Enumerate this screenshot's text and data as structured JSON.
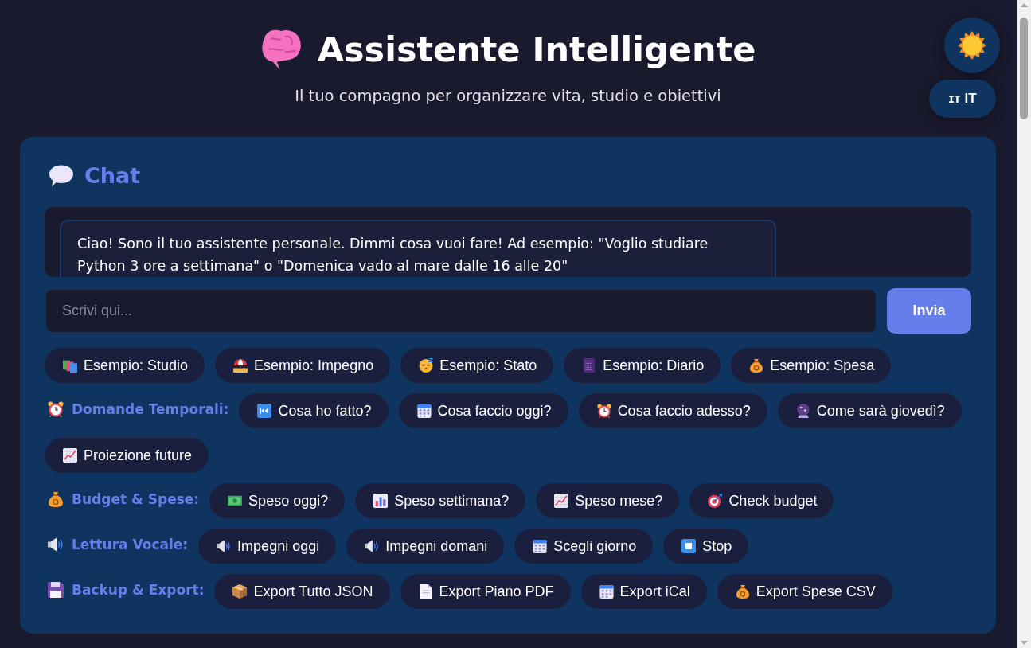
{
  "header": {
    "title": "Assistente Intelligente",
    "subtitle": "Il tuo compagno per organizzare vita, studio e obiettivi"
  },
  "language_button": {
    "label": "ɪᴛ IT"
  },
  "chat": {
    "title": "Chat",
    "messages": [
      {
        "text": "Ciao! Sono il tuo assistente personale. Dimmi cosa vuoi fare! Ad esempio: \"Voglio studiare Python 3 ore a settimana\" o \"Domenica vado al mare dalle 16 alle 20\""
      }
    ],
    "input": {
      "placeholder": "Scrivi qui..."
    },
    "send_button": {
      "label": "Invia"
    }
  },
  "sections": [
    {
      "buttons": [
        "Esempio: Studio",
        "Esempio: Impegno",
        "Esempio: Stato",
        "Esempio: Diario",
        "Esempio: Spesa"
      ]
    },
    {
      "label": "Domande Temporali:",
      "buttons": [
        "Cosa ho fatto?",
        "Cosa faccio oggi?",
        "Cosa faccio adesso?",
        "Come sarà giovedì?",
        "Proiezione future"
      ]
    },
    {
      "label": "Budget & Spese:",
      "buttons": [
        "Speso oggi?",
        "Speso settimana?",
        "Speso mese?",
        "Check budget"
      ]
    },
    {
      "label": "Lettura Vocale:",
      "buttons": [
        "Impegni oggi",
        "Impegni domani",
        "Scegli giorno",
        "Stop"
      ]
    },
    {
      "label": "Backup & Export:",
      "buttons": [
        "Export Tutto JSON",
        "Export Piano PDF",
        "Export iCal",
        "Export Spese CSV"
      ]
    }
  ]
}
